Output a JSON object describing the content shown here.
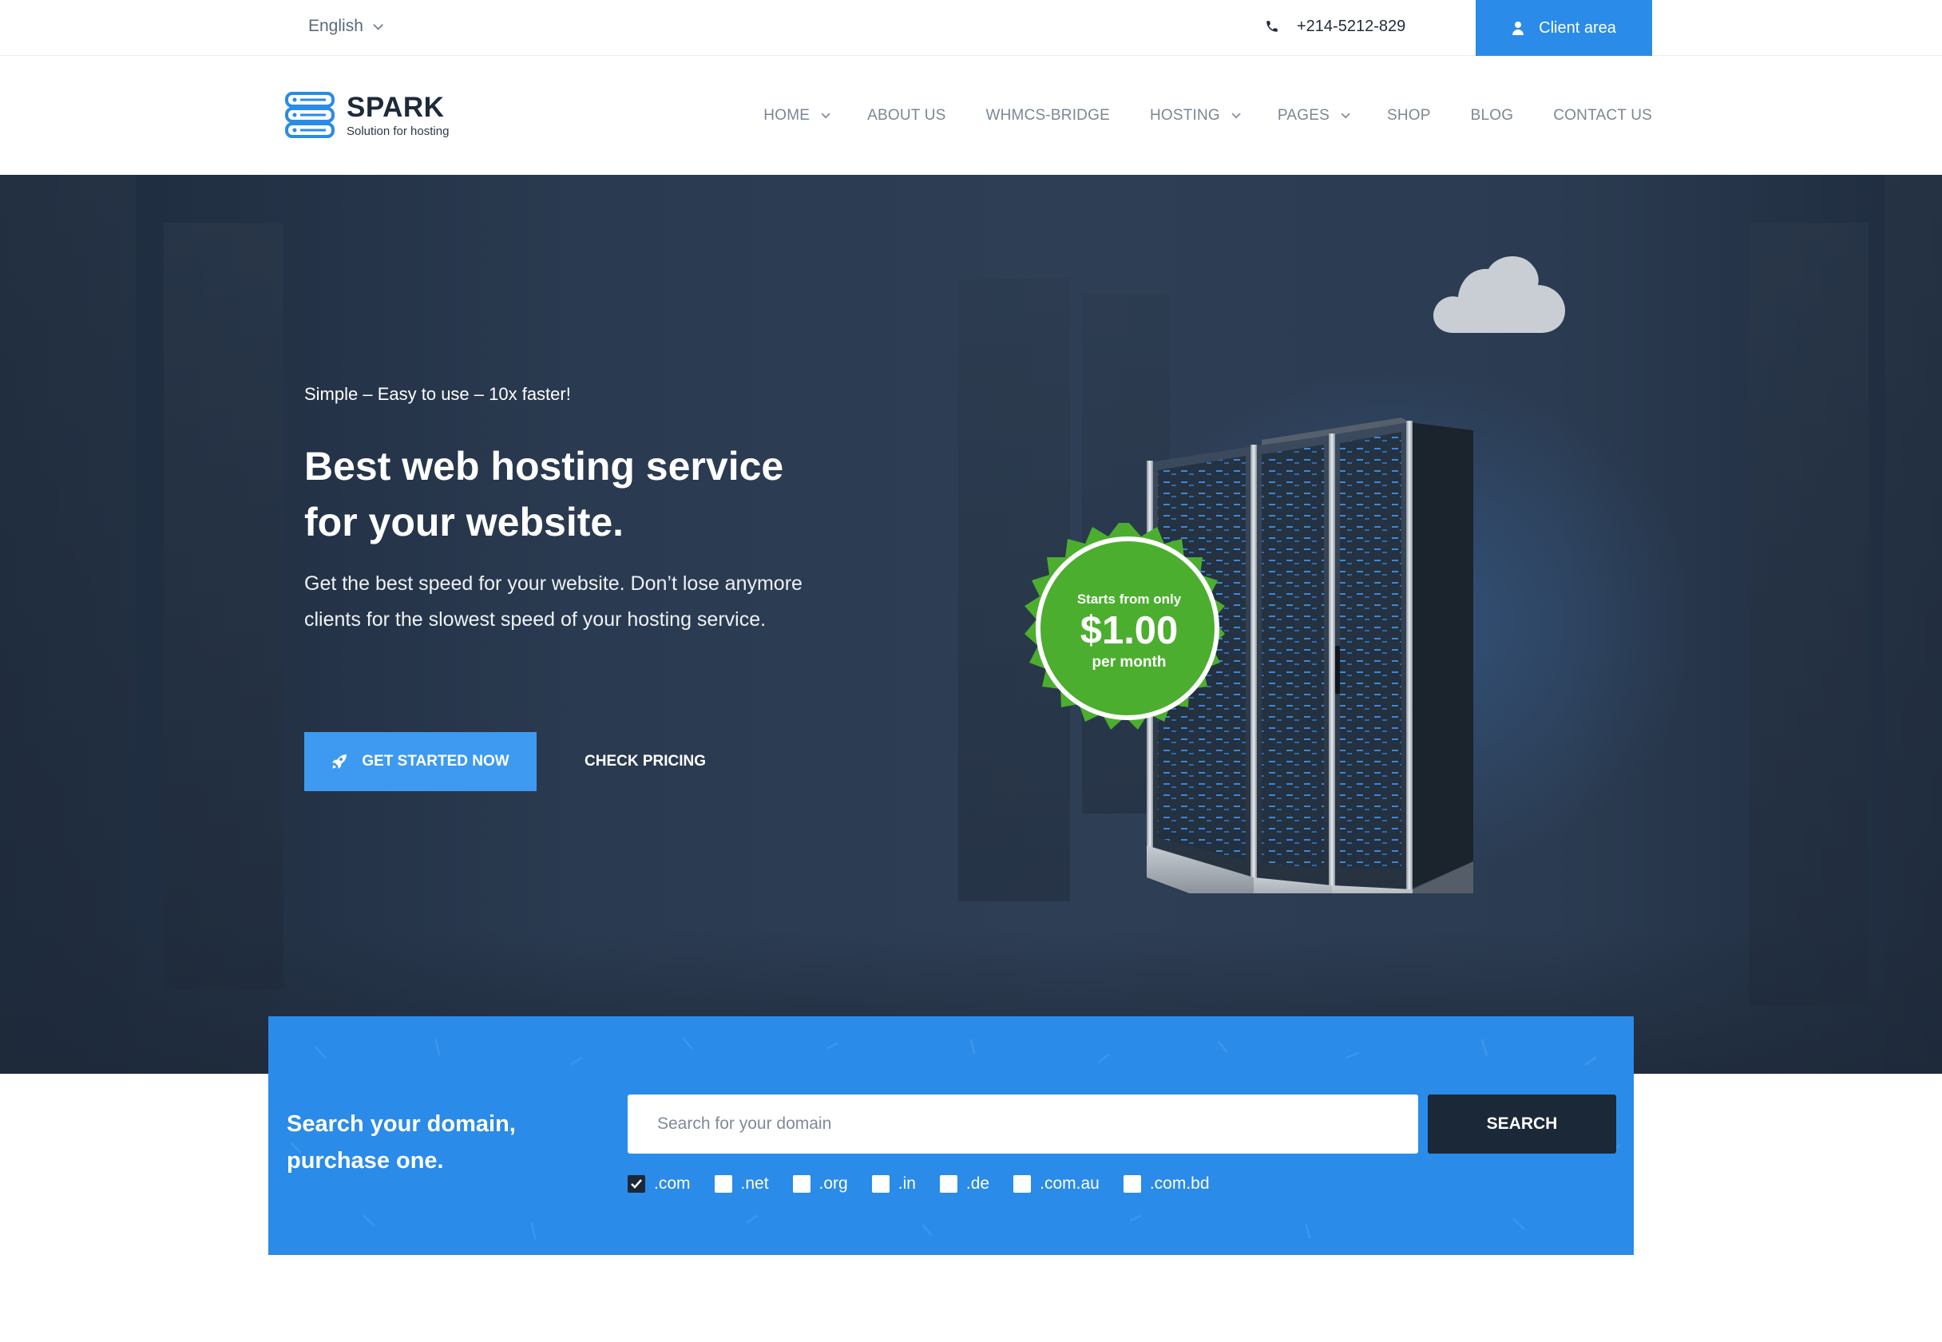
{
  "topbar": {
    "language": "English",
    "phone": "+214-5212-829",
    "client_area": "Client area"
  },
  "brand": {
    "name": "SPARK",
    "tagline": "Solution for hosting",
    "accent_color": "#2a8be8"
  },
  "nav": {
    "items": [
      {
        "label": "HOME",
        "dropdown": true
      },
      {
        "label": "ABOUT US",
        "dropdown": false
      },
      {
        "label": "WHMCS-BRIDGE",
        "dropdown": false
      },
      {
        "label": "HOSTING",
        "dropdown": true
      },
      {
        "label": "PAGES",
        "dropdown": true
      },
      {
        "label": "SHOP",
        "dropdown": false
      },
      {
        "label": "BLOG",
        "dropdown": false
      },
      {
        "label": "CONTACT US",
        "dropdown": false
      }
    ]
  },
  "hero": {
    "eyebrow": "Simple – Easy to use – 10x faster!",
    "title_line1": "Best web hosting service",
    "title_line2": "for your website.",
    "description": "Get the best speed for your website. Don’t lose anymore clients for the slowest speed of your hosting service.",
    "cta_primary": "GET STARTED NOW",
    "cta_secondary": "CHECK PRICING",
    "badge": {
      "line1": "Starts from only",
      "price": "$1.00",
      "line3": "per month",
      "color": "#4cae2f"
    }
  },
  "domain_search": {
    "title_line1": "Search your domain,",
    "title_line2": "purchase one.",
    "placeholder": "Search for your domain",
    "button": "SEARCH",
    "tlds": [
      {
        "label": ".com",
        "checked": true
      },
      {
        "label": ".net",
        "checked": false
      },
      {
        "label": ".org",
        "checked": false
      },
      {
        "label": ".in",
        "checked": false
      },
      {
        "label": ".de",
        "checked": false
      },
      {
        "label": ".com.au",
        "checked": false
      },
      {
        "label": ".com.bd",
        "checked": false
      }
    ]
  },
  "icons": {
    "language_chevron": "chevron-down-icon",
    "phone": "phone-icon",
    "client": "user-icon",
    "logo": "server-stack-icon",
    "cta": "rocket-icon",
    "check": "checkmark-icon"
  }
}
